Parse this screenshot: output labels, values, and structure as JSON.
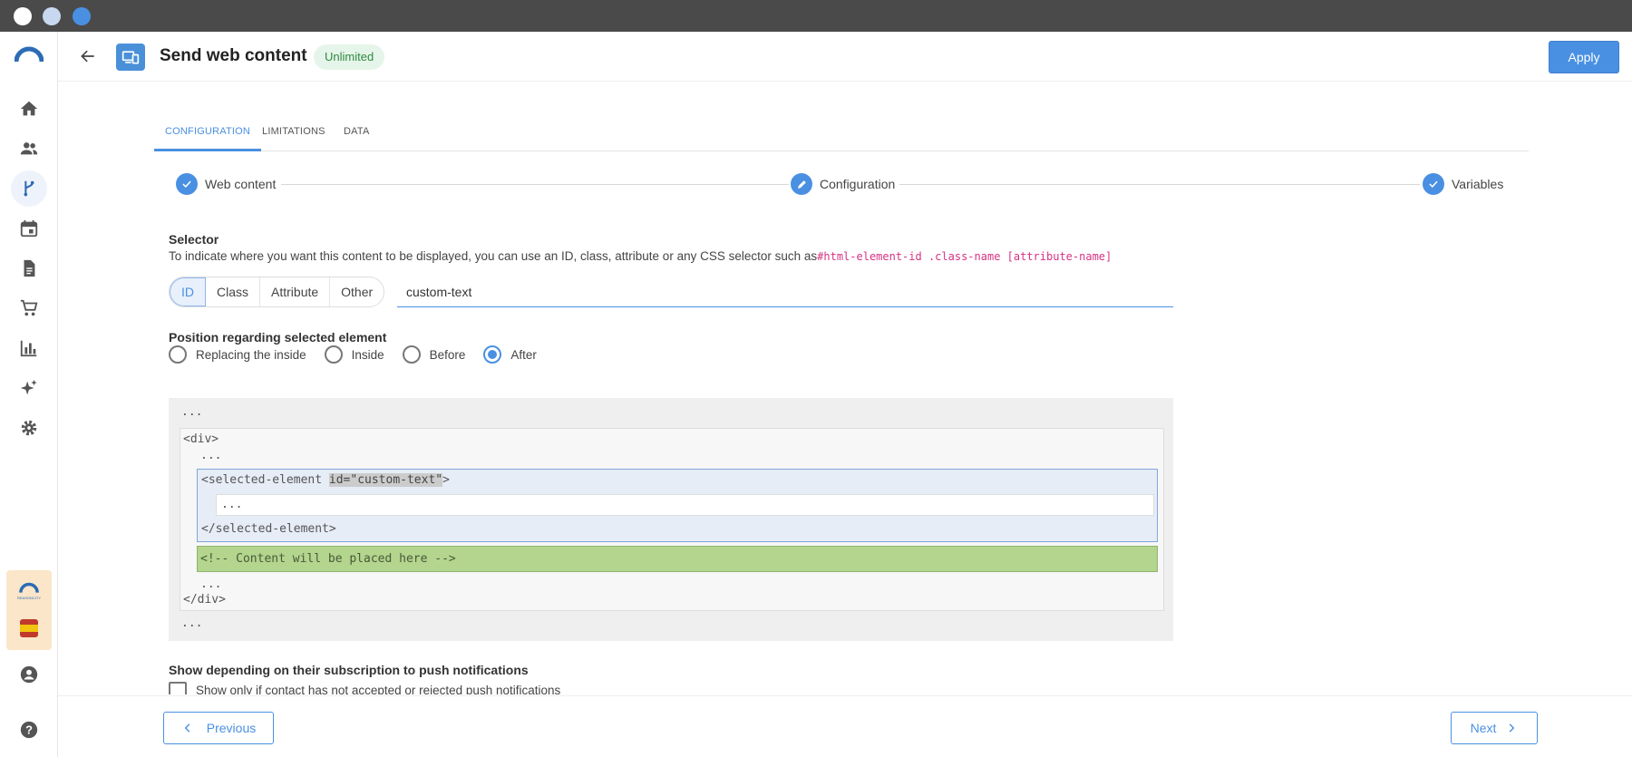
{
  "window": {
    "dot_colors": [
      "#ffffff",
      "#c8d8f0",
      "#4a90e2"
    ]
  },
  "sidebar": {
    "items": [
      {
        "icon": "home-icon"
      },
      {
        "icon": "users-icon"
      },
      {
        "icon": "workflow-icon",
        "active": true
      },
      {
        "icon": "calendar-icon"
      },
      {
        "icon": "document-icon"
      },
      {
        "icon": "cart-icon"
      },
      {
        "icon": "chart-icon"
      },
      {
        "icon": "sparkle-icon"
      },
      {
        "icon": "gear-icon"
      },
      {
        "icon": "account-icon"
      },
      {
        "icon": "help-icon"
      }
    ],
    "promo_logo_text": "REASONCITY"
  },
  "header": {
    "title": "Send web content",
    "badge": "Unlimited",
    "apply_label": "Apply"
  },
  "tabs": [
    {
      "label": "CONFIGURATION",
      "active": true
    },
    {
      "label": "LIMITATIONS"
    },
    {
      "label": "DATA"
    }
  ],
  "stepper": [
    {
      "label": "Web content",
      "state": "done"
    },
    {
      "label": "Configuration",
      "state": "editing"
    },
    {
      "label": "Variables",
      "state": "done"
    }
  ],
  "selector": {
    "title": "Selector",
    "description": "To indicate where you want this content to be displayed, you can use an ID, class, attribute or any CSS selector such as",
    "example": "#html-element-id .class-name [attribute-name]",
    "types": [
      "ID",
      "Class",
      "Attribute",
      "Other"
    ],
    "selected_type": "ID",
    "value": "custom-text"
  },
  "position": {
    "title": "Position regarding selected element",
    "options": [
      "Replacing the inside",
      "Inside",
      "Before",
      "After"
    ],
    "selected": "After"
  },
  "preview": {
    "ellipsis": "...",
    "div_open": "<div>",
    "sel_open": "<selected-element ",
    "sel_attr": "id=\"custom-text\"",
    "sel_close_bracket": ">",
    "sel_close": "</selected-element>",
    "placeholder": "<!-- Content will be placed here -->",
    "div_close": "</div>"
  },
  "push": {
    "title": "Show depending on their subscription to push notifications",
    "option": "Show only if contact has not accepted or rejected push notifications"
  },
  "footer": {
    "previous_label": "Previous",
    "next_label": "Next"
  },
  "colors": {
    "accent": "#4a90e2",
    "badge_bg": "#e6f5e9",
    "badge_text": "#2f8a43",
    "placeholder_bg": "#b3d58d"
  }
}
